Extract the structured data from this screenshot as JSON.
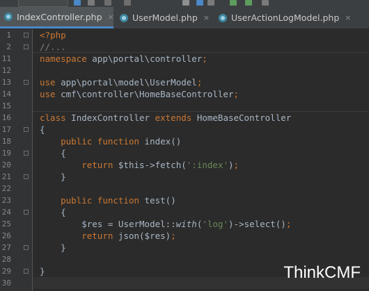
{
  "tabs": [
    {
      "label": "IndexController.php",
      "active": true
    },
    {
      "label": "UserModel.php",
      "active": false
    },
    {
      "label": "UserActionLogModel.php",
      "active": false
    }
  ],
  "close_glyph": "×",
  "lines": [
    {
      "num": "1",
      "code": "<?php"
    },
    {
      "num": "2",
      "code": "//..."
    },
    {
      "num": "11",
      "code": "namespace app\\portal\\controller;"
    },
    {
      "num": "12",
      "code": ""
    },
    {
      "num": "13",
      "code": "use app\\portal\\model\\UserModel;"
    },
    {
      "num": "14",
      "code": "use cmf\\controller\\HomeBaseController;"
    },
    {
      "num": "15",
      "code": ""
    },
    {
      "num": "16",
      "code": "class IndexController extends HomeBaseController"
    },
    {
      "num": "17",
      "code": "{"
    },
    {
      "num": "18",
      "code": "    public function index()"
    },
    {
      "num": "19",
      "code": "    {"
    },
    {
      "num": "20",
      "code": "        return $this->fetch(':index');"
    },
    {
      "num": "21",
      "code": "    }"
    },
    {
      "num": "22",
      "code": ""
    },
    {
      "num": "23",
      "code": "    public function test()"
    },
    {
      "num": "24",
      "code": "    {"
    },
    {
      "num": "25",
      "code": "        $res = UserModel::with('log')->select();"
    },
    {
      "num": "26",
      "code": "        return json($res);"
    },
    {
      "num": "27",
      "code": "    }"
    },
    {
      "num": "28",
      "code": ""
    },
    {
      "num": "29",
      "code": "}"
    },
    {
      "num": "30",
      "code": ""
    }
  ],
  "watermark": "ThinkCMF",
  "colors": {
    "keyword": "#cc7832",
    "string": "#6a8759",
    "comment": "#808080",
    "text": "#a9b7c6",
    "background": "#2b2b2b",
    "gutter": "#313335",
    "active_tab_underline": "#4a88c7"
  }
}
